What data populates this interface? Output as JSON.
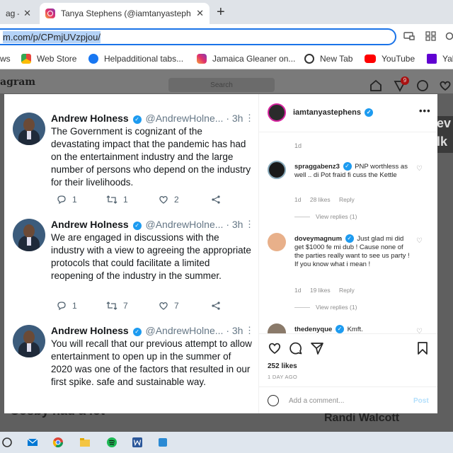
{
  "browser": {
    "inactive_tab_title": "ag –",
    "active_tab_title": "Tanya Stephens (@iamtanyasteph",
    "close_glyph": "✕",
    "new_tab_glyph": "+",
    "url": "m.com/p/CPmjUVzpjou/",
    "bookmarks": [
      {
        "label": "ws",
        "icon": "none",
        "color": ""
      },
      {
        "label": "Web Store",
        "icon": "webstore-icon",
        "color": "#e8453c"
      },
      {
        "label": "Helpadditional tabs...",
        "icon": "facebook-icon",
        "color": "#1877f2"
      },
      {
        "label": "Jamaica Gleaner on...",
        "icon": "instagram-icon",
        "color": "#e1306c"
      },
      {
        "label": "New Tab",
        "icon": "globe-icon",
        "color": "#333333"
      },
      {
        "label": "YouTube",
        "icon": "youtube-icon",
        "color": "#ff0000"
      },
      {
        "label": "Yah",
        "icon": "yahoo-icon",
        "color": "#6001d2"
      }
    ]
  },
  "background": {
    "logo": "agram",
    "search_placeholder": "Search",
    "notification_count": "9",
    "text_left": "Cosby had a lot",
    "text_right": "Randi Walcott",
    "side_texts": [
      "ev",
      "lk"
    ]
  },
  "tweets": [
    {
      "name": "Andrew Holness",
      "handle": "@AndrewHolne...",
      "time": "· 3h",
      "more": "⋮",
      "text": "The Government is cognizant of the devastating impact that the pandemic has had on the entertainment industry and the large number of persons who depend on the industry for their livelihoods.",
      "replies": "1",
      "retweets": "1",
      "likes": "2"
    },
    {
      "name": "Andrew Holness",
      "handle": "@AndrewHolne...",
      "time": "· 3h",
      "more": "⋮",
      "text": "We are engaged in discussions with the industry with a view to agreeing the appropriate protocols that could facilitate a limited reopening of the industry in the summer.",
      "replies": "1",
      "retweets": "7",
      "likes": "7"
    },
    {
      "name": "Andrew Holness",
      "handle": "@AndrewHolne...",
      "time": "· 3h",
      "more": "⋮",
      "text": "You will recall that our previous attempt to allow entertainment to open up in the summer of 2020 was one of the factors that resulted in our first spike. safe and sustainable way.",
      "replies": "",
      "retweets": "",
      "likes": ""
    }
  ],
  "post": {
    "username": "iamtanyastephens",
    "more": "•••",
    "age": "1d",
    "comments": [
      {
        "user": "spraggabenz3",
        "text": "PNP worthless as well .. di Pot fraid fi cuss the Kettle",
        "time": "1d",
        "likes": "28 likes",
        "reply": "Reply",
        "view_replies": "View replies (1)"
      },
      {
        "user": "doveymagnum",
        "text": "Just glad mi did get $1000 fe mi dub ! Cause none of the parties really want to see us party ! If you know what i mean !",
        "time": "1d",
        "likes": "19 likes",
        "reply": "Reply",
        "view_replies": "View replies (1)"
      },
      {
        "user": "thedenyque",
        "text": "Kmft.",
        "time": "",
        "likes": "",
        "reply": "",
        "view_replies": ""
      }
    ],
    "like_count": "252 likes",
    "posted_ago": "1 DAY AGO",
    "add_comment_placeholder": "Add a comment...",
    "post_label": "Post"
  }
}
